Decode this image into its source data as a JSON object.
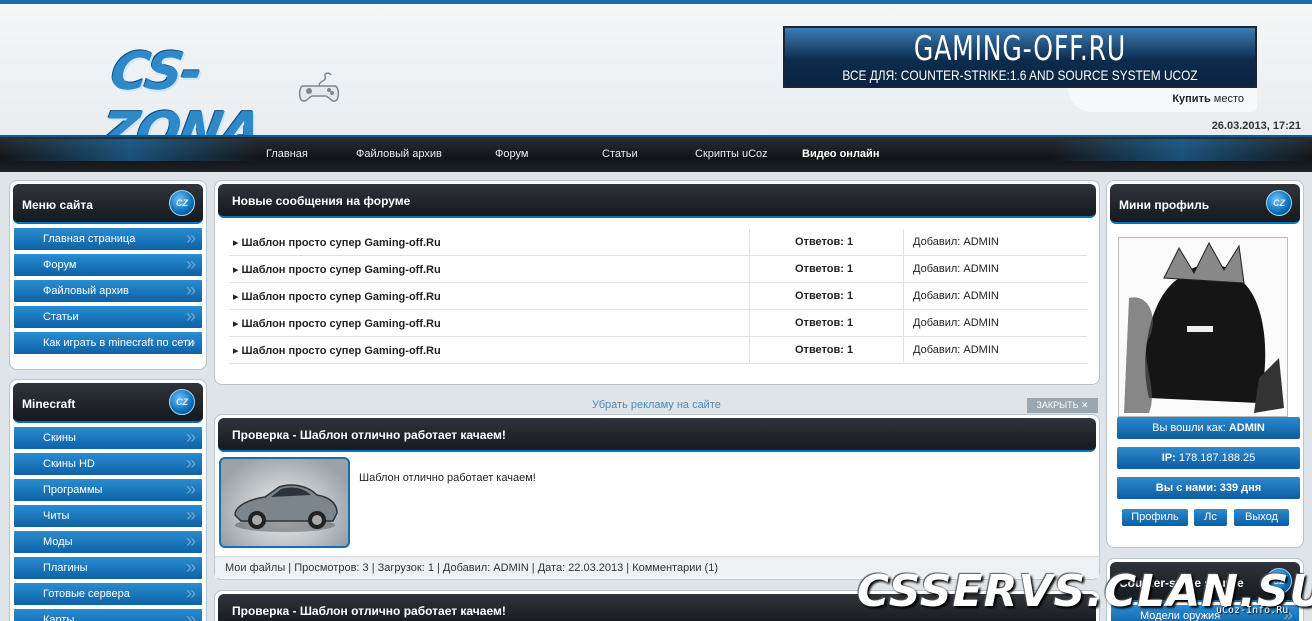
{
  "header": {
    "logo_text": "CS-ZONA",
    "banner_title": "GAMING-OFF.RU",
    "banner_subtitle": "ВСЕ ДЛЯ: COUNTER-STRIKE:1.6 AND SOURCE SYSTEM UCOZ",
    "buy_bold": "Купить",
    "buy_rest": "место",
    "datetime": "26.03.2013, 17:21"
  },
  "nav": [
    "Главная",
    "Файловый архив",
    "Форум",
    "Статьи",
    "Скрипты uCoz",
    "Видео онлайн"
  ],
  "left_menu": {
    "title": "Меню сайта",
    "items": [
      "Главная страница",
      "Форум",
      "Файловый архив",
      "Статьи",
      "Как играть в minecraft по сети"
    ]
  },
  "minecraft_menu": {
    "title": "Minecraft",
    "items": [
      "Скины",
      "Скины HD",
      "Программы",
      "Читы",
      "Моды",
      "Плагины",
      "Готовые сервера",
      "Карты"
    ]
  },
  "badge_text": "CZ",
  "forum": {
    "title": "Новые сообщения на форуме",
    "rows": [
      {
        "topic": "Шаблон просто супер Gaming-off.Ru",
        "replies": "Ответов: 1",
        "added": "Добавил: ADMIN"
      },
      {
        "topic": "Шаблон просто супер Gaming-off.Ru",
        "replies": "Ответов: 1",
        "added": "Добавил: ADMIN"
      },
      {
        "topic": "Шаблон просто супер Gaming-off.Ru",
        "replies": "Ответов: 1",
        "added": "Добавил: ADMIN"
      },
      {
        "topic": "Шаблон просто супер Gaming-off.Ru",
        "replies": "Ответов: 1",
        "added": "Добавил: ADMIN"
      },
      {
        "topic": "Шаблон просто супер Gaming-off.Ru",
        "replies": "Ответов: 1",
        "added": "Добавил: ADMIN"
      }
    ]
  },
  "ads": {
    "remove_link": "Убрать рекламу на сайте",
    "close": "ЗАКРЫТЬ ✕"
  },
  "post1": {
    "title": "Проверка - Шаблон отлично работает качаем!",
    "text": "Шаблон отлично работает качаем!",
    "meta": "Мои файлы | Просмотров: 3 | Загрузок: 1 | Добавил: ADMIN | Дата: 22.03.2013 | Комментарии (1)"
  },
  "post2": {
    "title": "Проверка - Шаблон отлично работает качаем!"
  },
  "profile": {
    "title": "Мини профиль",
    "logged_in_label": "Вы вошли как:",
    "logged_in_user": "ADMIN",
    "ip_label": "IP:",
    "ip_value": "178.187.188.25",
    "with_us": "Вы с нами: 339 дня",
    "btn_profile": "Профиль",
    "btn_pm": "Лс",
    "btn_exit": "Выход"
  },
  "right_block2": {
    "title": "Counter-strike source",
    "first_item": "Модели оружия"
  },
  "watermark": {
    "main": "CSSERVS.CLAN.SU",
    "small": "uCoz-Info.Ru"
  }
}
